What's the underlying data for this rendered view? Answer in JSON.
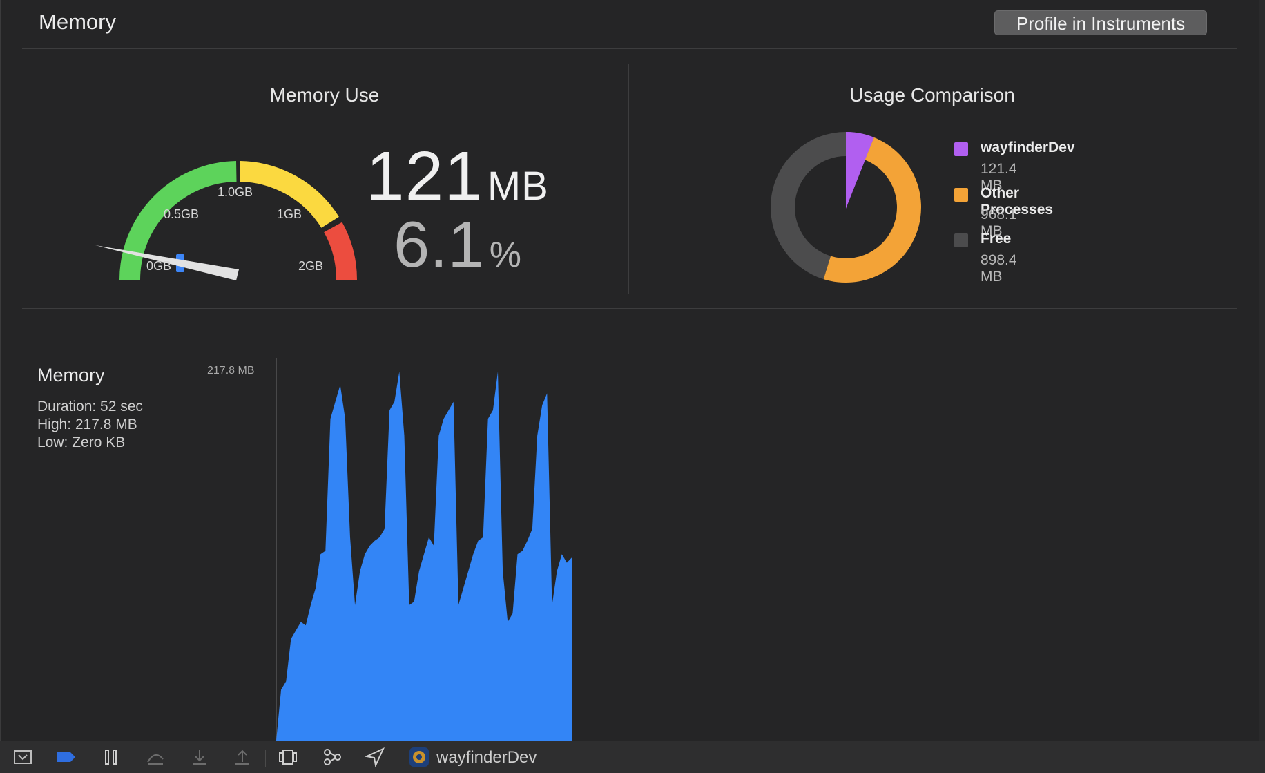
{
  "header": {
    "title": "Memory",
    "profile_button_label": "Profile in Instruments"
  },
  "memory_use": {
    "title": "Memory Use",
    "value": "121",
    "value_unit": "MB",
    "percent": "6.1",
    "percent_unit": "%",
    "gauge_labels": [
      "0GB",
      "0.5GB",
      "1.0GB",
      "1GB",
      "2GB"
    ],
    "gauge_fraction": 0.06,
    "gauge_colors": {
      "green": "#5dd35b",
      "yellow": "#fbd940",
      "red": "#ec4d3f",
      "needle": "#e2e2e2",
      "marker": "#3d86f7"
    }
  },
  "usage_comparison": {
    "title": "Usage Comparison",
    "items": [
      {
        "name": "wayfinderDev",
        "value": "121.4 MB",
        "color": "#b15ff0",
        "mb": 121.4
      },
      {
        "name": "Other Processes",
        "value": "968.1 MB",
        "color": "#f3a337",
        "mb": 968.1
      },
      {
        "name": "Free",
        "value": "898.4 MB",
        "color": "#4c4c4d",
        "mb": 898.4
      }
    ]
  },
  "graph": {
    "title": "Memory",
    "duration": "Duration: 52 sec",
    "high": "High: 217.8 MB",
    "low": "Low: Zero KB",
    "y_max_label": "217.8 MB"
  },
  "chart_data": {
    "type": "area",
    "title": "Memory",
    "xlabel": "",
    "ylabel": "",
    "ylim": [
      0,
      217.8
    ],
    "color": "#3385f6",
    "series": [
      {
        "values": [
          0,
          30,
          35,
          60,
          65,
          70,
          68,
          80,
          90,
          110,
          112,
          190,
          200,
          210,
          190,
          120,
          80,
          100,
          110,
          115,
          118,
          120,
          125,
          195,
          200,
          217.8,
          180,
          80,
          82,
          100,
          110,
          120,
          115,
          180,
          190,
          195,
          200,
          80,
          90,
          100,
          110,
          118,
          120,
          190,
          195,
          217.8,
          100,
          70,
          75,
          110,
          112,
          118,
          125,
          180,
          198,
          205,
          80,
          100,
          110,
          105,
          108
        ]
      }
    ]
  },
  "toolbar": {
    "icons": [
      "hide-debug-area-icon",
      "breakpoints-icon",
      "pause-icon",
      "step-over-icon",
      "step-into-icon",
      "step-out-icon",
      "view-debugger-icon",
      "memory-graph-icon",
      "location-icon",
      "app-icon"
    ],
    "app_name": "wayfinderDev"
  }
}
